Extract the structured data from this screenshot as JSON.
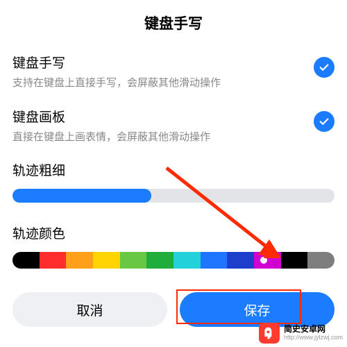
{
  "title": "键盘手写",
  "sections": {
    "handwrite": {
      "label": "键盘手写",
      "desc": "支持在键盘上直接手写，会屏蔽其他滑动操作",
      "enabled": true
    },
    "drawboard": {
      "label": "键盘画板",
      "desc": "直接在键盘上画表情，会屏蔽其他滑动操作",
      "enabled": true
    }
  },
  "thickness": {
    "label": "轨迹粗细",
    "percent": 43
  },
  "color": {
    "label": "轨迹颜色",
    "swatches": [
      "#000000",
      "#ff2d2d",
      "#ff9f1a",
      "#ffd400",
      "#68c743",
      "#1fad3c",
      "#22d1d9",
      "#1f75ff",
      "#1d3fcc",
      "#d000d0",
      "#000000",
      "#7e7e7e"
    ],
    "handle_pos_percent": 78,
    "handle_color": "#d000d0"
  },
  "accent": "#1b7cff",
  "buttons": {
    "cancel": "取消",
    "save": "保存"
  },
  "watermark": {
    "name": "简史安卓网",
    "url": "http://www.jylzwj.com"
  }
}
